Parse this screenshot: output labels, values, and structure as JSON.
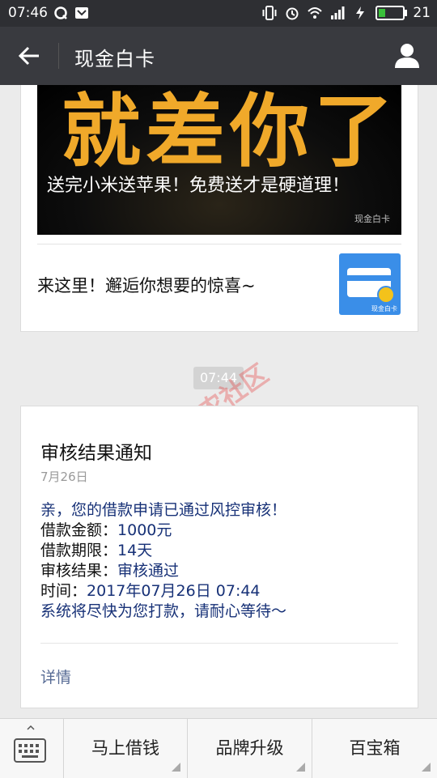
{
  "status_bar": {
    "time": "07:46",
    "battery": "21"
  },
  "header": {
    "title": "现金白卡"
  },
  "article_card": {
    "banner_big_text": "就差你了",
    "banner_caption": "送完小米送苹果！免费送才是硬道理！",
    "banner_watermark": "现金白卡",
    "link_text": "来这里！邂逅你想要的惊喜~",
    "thumb_watermark": "现金白卡"
  },
  "timestamp_badge": "07:44",
  "watermark_text": "卡农社区",
  "notice": {
    "title": "审核结果通知",
    "date": "7月26日",
    "greeting": "亲，您的借款申请已通过风控审核！",
    "rows": [
      {
        "label": "借款金额：",
        "value": "1000元"
      },
      {
        "label": "借款期限：",
        "value": "14天"
      },
      {
        "label": "审核结果：",
        "value": "审核通过"
      },
      {
        "label": "时间：",
        "value": "2017年07月26日 07:44"
      }
    ],
    "closing": "系统将尽快为您打款，请耐心等待～",
    "detail_link": "详情"
  },
  "bottom_menu": {
    "items": [
      "马上借钱",
      "品牌升级",
      "百宝箱"
    ]
  }
}
